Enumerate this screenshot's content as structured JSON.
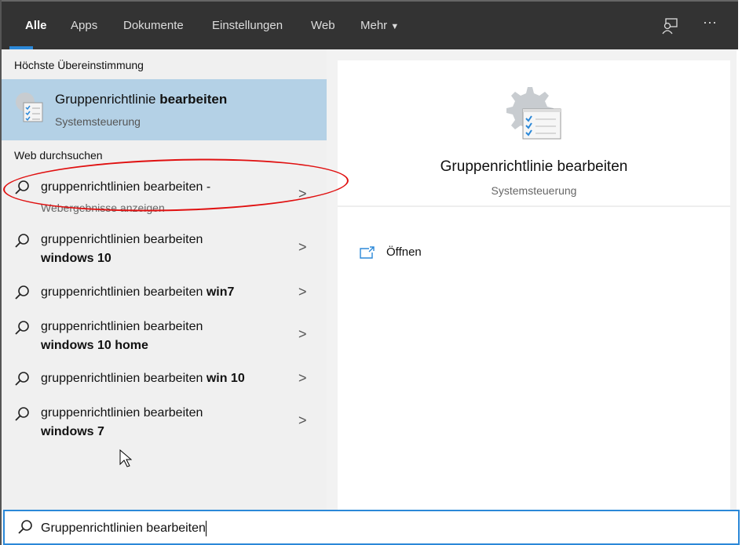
{
  "tabs": [
    {
      "label": "Alle"
    },
    {
      "label": "Apps"
    },
    {
      "label": "Dokumente"
    },
    {
      "label": "Einstellungen"
    },
    {
      "label": "Web"
    },
    {
      "label": "Mehr"
    }
  ],
  "best_match": {
    "header": "Höchste Übereinstimmung",
    "title_normal": "Gruppenrichtlinie ",
    "title_bold": "bearbeiten",
    "subtitle": "Systemsteuerung"
  },
  "web": {
    "header": "Web durchsuchen",
    "items": [
      {
        "normal": "gruppenrichtlinien bearbeiten -",
        "bold": "",
        "sub": "Webergebnisse anzeigen"
      },
      {
        "normal": "gruppenrichtlinien bearbeiten",
        "bold": "windows 10"
      },
      {
        "normal": "gruppenrichtlinien bearbeiten ",
        "bold": "win7"
      },
      {
        "normal": "gruppenrichtlinien bearbeiten",
        "bold": "windows 10 home"
      },
      {
        "normal": "gruppenrichtlinien bearbeiten ",
        "bold": "win 10"
      },
      {
        "normal": "gruppenrichtlinien bearbeiten",
        "bold": "windows 7"
      }
    ]
  },
  "preview": {
    "title": "Gruppenrichtlinie bearbeiten",
    "subtitle": "Systemsteuerung",
    "open_label": "Öffnen"
  },
  "search": {
    "value": "Gruppenrichtlinien bearbeiten"
  },
  "colors": {
    "accent": "#2b88d8",
    "selected": "#b4d1e6",
    "annotation": "#e01010"
  }
}
